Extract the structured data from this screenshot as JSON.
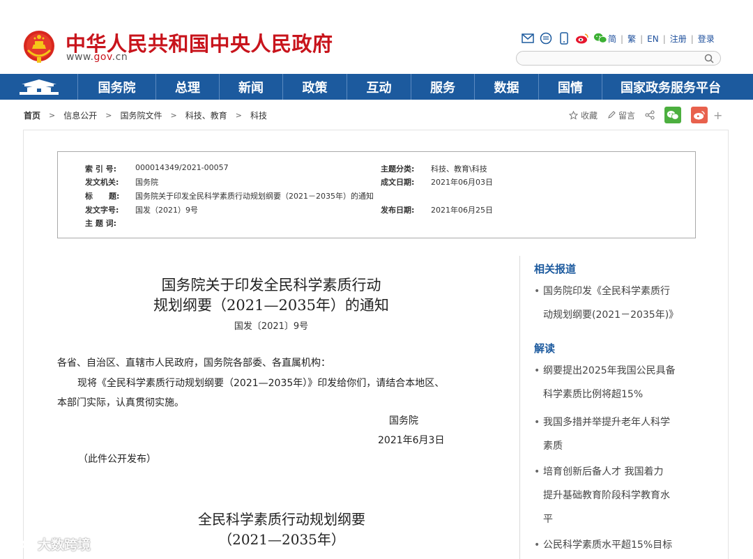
{
  "header": {
    "site_title": "中华人民共和国中央人民政府",
    "domain_prefix": "www.",
    "domain_brand": "gov",
    "domain_suffix": ".cn",
    "top_links": [
      "简",
      "繁",
      "EN",
      "注册",
      "登录"
    ],
    "search_placeholder": ""
  },
  "nav": {
    "items": [
      "国务院",
      "总理",
      "新闻",
      "政策",
      "互动",
      "服务",
      "数据",
      "国情",
      "国家政务服务平台"
    ]
  },
  "breadcrumb": [
    "首页",
    "信息公开",
    "国务院文件",
    "科技、教育",
    "科技"
  ],
  "actions": {
    "favorite": "收藏",
    "comment": "留言"
  },
  "info": {
    "index_label": "索 引 号:",
    "index_value": "000014349/2021-00057",
    "topic_label": "主题分类:",
    "topic_value": "科技、教育\\科技",
    "issuer_label": "发文机关:",
    "issuer_value": "国务院",
    "date_label": "成文日期:",
    "date_value": "2021年06月03日",
    "title_label": "标      题:",
    "title_value": "国务院关于印发全民科学素质行动规划纲要（2021－2035年）的通知",
    "docno_label": "发文字号:",
    "docno_value": "国发（2021）9号",
    "pubdate_label": "发布日期:",
    "pubdate_value": "2021年06月25日",
    "keywords_label": "主 题 词:"
  },
  "article": {
    "title_line1": "国务院关于印发全民科学素质行动",
    "title_line2": "规划纲要（2021—2035年）的通知",
    "doc_number": "国发〔2021〕9号",
    "salutation": "各省、自治区、直辖市人民政府，国务院各部委、各直属机构：",
    "body_line1": "现将《全民科学素质行动规划纲要（2021—2035年）》印发给你们，请结合本地区、",
    "body_line2": "本部门实际，认真贯彻实施。",
    "signer": "国务院",
    "sign_date": "2021年6月3日",
    "publish_note": "（此件公开发布）",
    "sub_title_line1": "全民科学素质行动规划纲要",
    "sub_title_line2": "（2021—2035年）"
  },
  "sidebar": {
    "related_heading": "相关报道",
    "related_items": [
      {
        "line1": "国务院印发《全民科学素质行",
        "line2": "动规划纲要(2021－2035年)》"
      }
    ],
    "interpret_heading": "解读",
    "interpret_items": [
      {
        "line1": "纲要提出2025年我国公民具备",
        "line2": "科学素质比例将超15%"
      },
      {
        "line1": "我国多措并举提升老年人科学",
        "line2": "素质"
      },
      {
        "line1": "培育创新后备人才 我国着力",
        "line2": "提升基础教育阶段科学教育水",
        "line3": "平"
      },
      {
        "line1": "公民科学素质水平超15%目标"
      }
    ]
  },
  "watermark": "大数跨境",
  "colors": {
    "brand_red": "#c8141c",
    "nav_blue": "#1c5a9e",
    "link_blue": "#1d4f9c"
  }
}
